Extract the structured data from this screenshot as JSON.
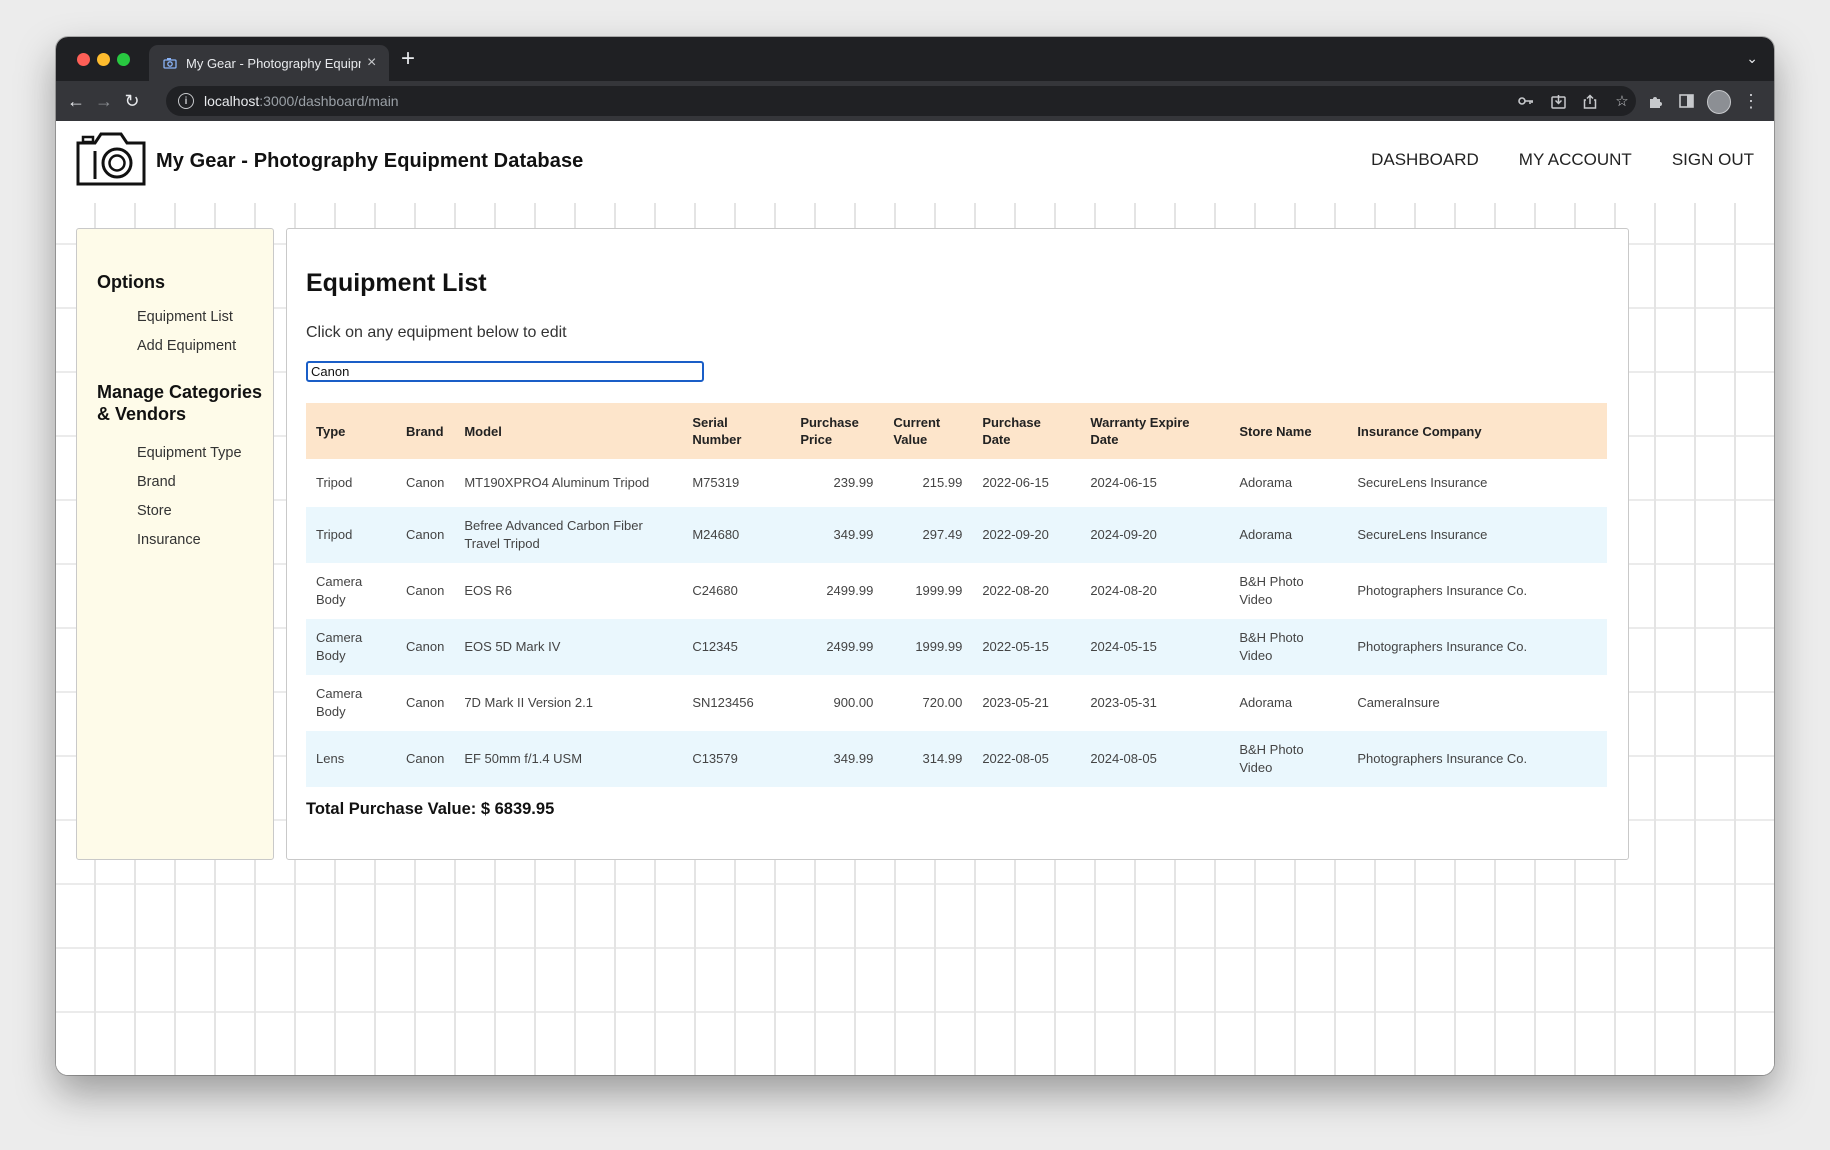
{
  "browser": {
    "tab_title": "My Gear - Photography Equipm",
    "url_host": "localhost",
    "url_path": ":3000/dashboard/main"
  },
  "site": {
    "title": "My Gear - Photography Equipment Database",
    "nav": [
      "DASHBOARD",
      "MY ACCOUNT",
      "SIGN OUT"
    ]
  },
  "sidebar": {
    "options_heading": "Options",
    "options_items": [
      "Equipment List",
      "Add Equipment"
    ],
    "manage_heading_line1": "Manage Categories",
    "manage_heading_line2": "& Vendors",
    "manage_items": [
      "Equipment Type",
      "Brand",
      "Store",
      "Insurance"
    ]
  },
  "main": {
    "heading": "Equipment List",
    "subtitle": "Click on any equipment below to edit",
    "search_value": "Canon",
    "columns": [
      "Type",
      "Brand",
      "Model",
      "Serial Number",
      "Purchase Price",
      "Current Value",
      "Purchase Date",
      "Warranty Expire Date",
      "Store Name",
      "Insurance Company"
    ],
    "rows": [
      [
        "Tripod",
        "Canon",
        "MT190XPRO4 Aluminum Tripod",
        "M75319",
        "239.99",
        "215.99",
        "2022-06-15",
        "2024-06-15",
        "Adorama",
        "SecureLens Insurance"
      ],
      [
        "Tripod",
        "Canon",
        "Befree Advanced Carbon Fiber Travel Tripod",
        "M24680",
        "349.99",
        "297.49",
        "2022-09-20",
        "2024-09-20",
        "Adorama",
        "SecureLens Insurance"
      ],
      [
        "Camera Body",
        "Canon",
        "EOS R6",
        "C24680",
        "2499.99",
        "1999.99",
        "2022-08-20",
        "2024-08-20",
        "B&H Photo Video",
        "Photographers Insurance Co."
      ],
      [
        "Camera Body",
        "Canon",
        "EOS 5D Mark IV",
        "C12345",
        "2499.99",
        "1999.99",
        "2022-05-15",
        "2024-05-15",
        "B&H Photo Video",
        "Photographers Insurance Co."
      ],
      [
        "Camera Body",
        "Canon",
        "7D Mark II Version 2.1",
        "SN123456",
        "900.00",
        "720.00",
        "2023-05-21",
        "2023-05-31",
        "Adorama",
        "CameraInsure"
      ],
      [
        "Lens",
        "Canon",
        "EF 50mm f/1.4 USM",
        "C13579",
        "349.99",
        "314.99",
        "2022-08-05",
        "2024-08-05",
        "B&H Photo Video",
        "Photographers Insurance Co."
      ]
    ],
    "total_label": "Total Purchase Value: $ 6839.95"
  },
  "colors": {
    "sidebar_bg": "#fefbe9",
    "table_header_bg": "#fde5cb",
    "row_alt_bg": "#eaf7fd",
    "search_border": "#1a5ec7"
  }
}
